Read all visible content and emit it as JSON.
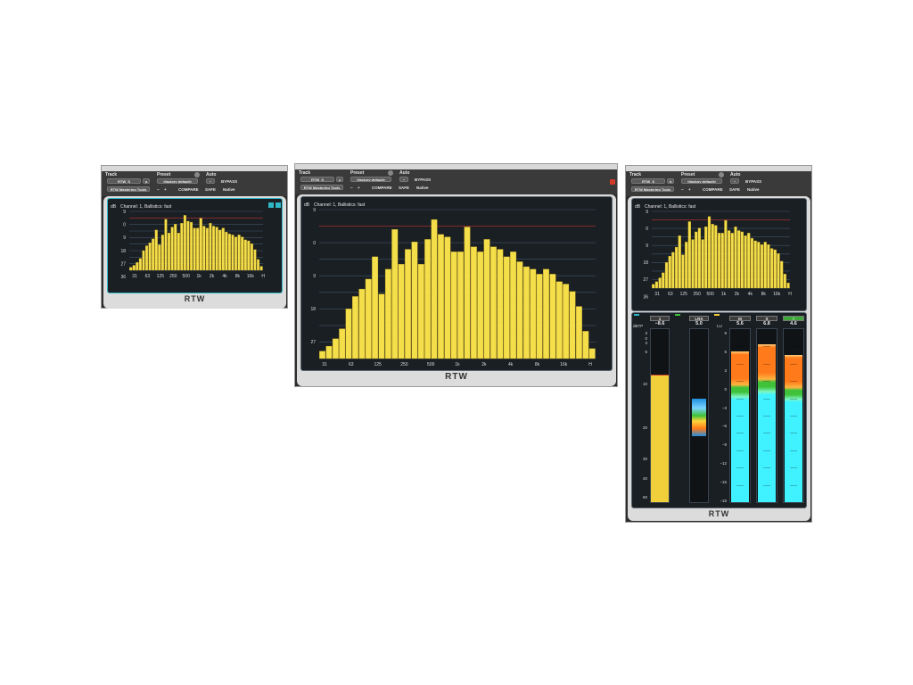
{
  "header": {
    "track_label": "Track",
    "preset_label": "Preset",
    "auto_label": "Auto",
    "track_name_a": "RTW_S",
    "track_suffix_a": "a",
    "track_name_b": "RTW_S",
    "track_suffix_b": "c",
    "track_name_c": "RTW_S",
    "track_suffix_c": "b",
    "preset_value": "<factory default>",
    "preset_dash": "−",
    "bypass_label": "BYPASS",
    "plugin_name": "RTW Mastering Tools",
    "minus": "−",
    "plus": "+",
    "compare_label": "COMPARE",
    "safe_label": "SAFE",
    "native_label": "Native"
  },
  "rta": {
    "title": "Channel: 1, Ballistics: fast",
    "unit": "dB",
    "yticks": [
      "9",
      "0",
      "9",
      "18",
      "27",
      "36"
    ],
    "xticks": [
      "31",
      "63",
      "125",
      "250",
      "500",
      "1k",
      "2k",
      "4k",
      "8k",
      "16k",
      "H"
    ],
    "bands": [
      3,
      5,
      8,
      12,
      20,
      25,
      28,
      32,
      41,
      26,
      36,
      52,
      38,
      44,
      47,
      38,
      48,
      56,
      50,
      49,
      43,
      43,
      53,
      45,
      43,
      48,
      45,
      44,
      41,
      43,
      39,
      37,
      36,
      34,
      36,
      34,
      31,
      30,
      27,
      21,
      11,
      4
    ],
    "yrange": [
      -12,
      36
    ]
  },
  "loudness": {
    "tp_label": "1",
    "tp_unit": "dBTP",
    "tp_value": "−8.6",
    "tp_scale": [
      "3",
      "0",
      "3",
      "6",
      "10",
      "20",
      "30",
      "40",
      "60"
    ],
    "tp_fill": 0.73,
    "lra_label": "LRA",
    "lra_value": "5.0",
    "lu_unit": "LU",
    "lu_scale": [
      "9",
      "6",
      "3",
      "0",
      "−3",
      "−6",
      "−9",
      "−12",
      "−15",
      "−18"
    ],
    "m_label": "M",
    "m_value": "5.6",
    "m_level": 0.87,
    "s_label": "S",
    "s_value": "6.8",
    "s_level": 0.91,
    "i_label": "I",
    "i_value": "4.6",
    "i_level": 0.85
  },
  "logo": "RTW",
  "colors": {
    "bar": "#f4de4a",
    "bar_dark": "#c9a51c",
    "panel": "#1a1f24",
    "cyan": "#40f2ff",
    "orange": "#ff7a1a",
    "green": "#3fc23a",
    "red": "#c03030"
  }
}
